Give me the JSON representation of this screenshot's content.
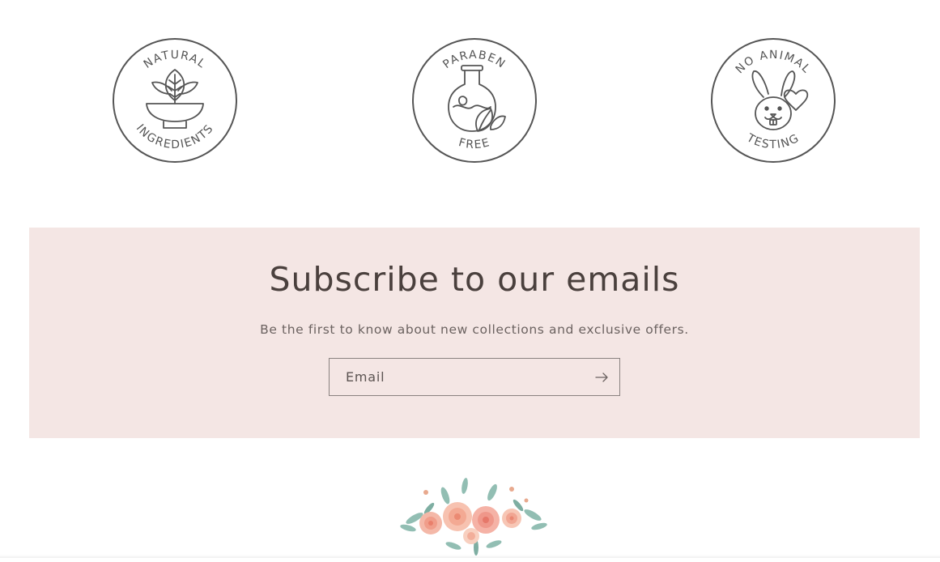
{
  "badges": [
    {
      "name": "natural-ingredients",
      "top_text": "NATURAL",
      "bottom_text": "INGREDIENTS",
      "icon": "leaf-bowl-icon"
    },
    {
      "name": "paraben-free",
      "top_text": "PARABEN",
      "bottom_text": "FREE",
      "icon": "flask-leaf-icon"
    },
    {
      "name": "no-animal-testing",
      "top_text": "NO ANIMAL",
      "bottom_text": "TESTING",
      "icon": "rabbit-heart-icon"
    }
  ],
  "subscribe": {
    "title": "Subscribe to our emails",
    "description": "Be the first to know about new collections and exclusive offers.",
    "email_placeholder": "Email",
    "submit_icon": "arrow-right-icon"
  },
  "footer": {
    "decoration_icon": "floral-arrangement-icon"
  },
  "colors": {
    "banner_background": "#f4e6e4",
    "title_text": "#4a403d",
    "badge_stroke": "#555555"
  }
}
